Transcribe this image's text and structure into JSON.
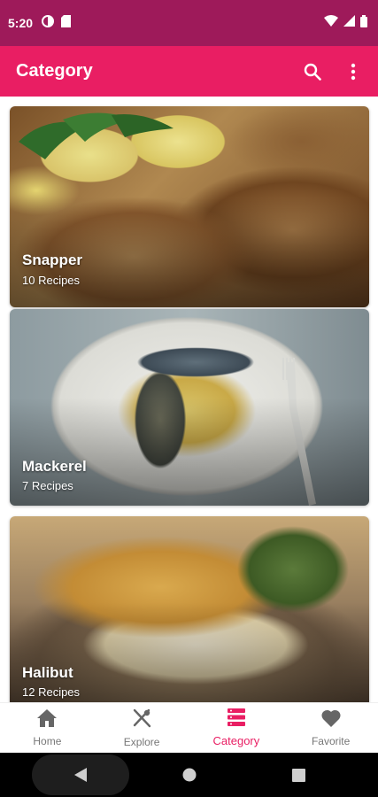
{
  "status_bar": {
    "time": "5:20",
    "icons": [
      "data-saver-icon",
      "sd-card-icon",
      "wifi-icon",
      "signal-icon",
      "battery-icon"
    ]
  },
  "app_bar": {
    "title": "Category",
    "actions": [
      "search-icon",
      "more-vert-icon"
    ],
    "color": "#e91e63"
  },
  "categories": [
    {
      "name": "Snapper",
      "recipes": "10 Recipes"
    },
    {
      "name": "Mackerel",
      "recipes": "7 Recipes"
    },
    {
      "name": "Halibut",
      "recipes": "12 Recipes"
    }
  ],
  "bottom_nav": {
    "items": [
      {
        "label": "Home",
        "icon": "home-icon",
        "active": false
      },
      {
        "label": "Explore",
        "icon": "fork-knife-icon",
        "active": false
      },
      {
        "label": "Category",
        "icon": "category-icon",
        "active": true
      },
      {
        "label": "Favorite",
        "icon": "heart-icon",
        "active": false
      }
    ],
    "active_color": "#e91e63"
  },
  "system_nav": [
    "back-icon",
    "home-circle-icon",
    "recents-icon"
  ]
}
